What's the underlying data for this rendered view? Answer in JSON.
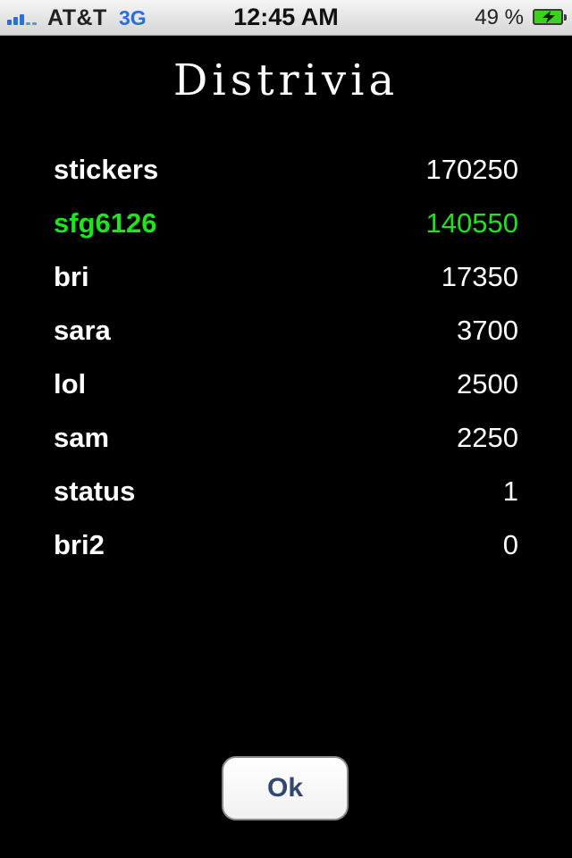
{
  "status_bar": {
    "carrier": "AT&T",
    "network": "3G",
    "time": "12:45 AM",
    "battery_percent": "49 %",
    "signal_icon": "signal-strength-icon",
    "battery_icon": "battery-charging-icon"
  },
  "app": {
    "title": "Distrivia"
  },
  "scores": [
    {
      "name": "stickers",
      "score": "170250",
      "highlight": false
    },
    {
      "name": "sfg6126",
      "score": "140550",
      "highlight": true
    },
    {
      "name": "bri",
      "score": "17350",
      "highlight": false
    },
    {
      "name": "sara",
      "score": "3700",
      "highlight": false
    },
    {
      "name": "lol",
      "score": "2500",
      "highlight": false
    },
    {
      "name": "sam",
      "score": "2250",
      "highlight": false
    },
    {
      "name": "status",
      "score": "1",
      "highlight": false
    },
    {
      "name": "bri2",
      "score": "0",
      "highlight": false
    }
  ],
  "actions": {
    "ok_label": "Ok"
  },
  "colors": {
    "background": "#000000",
    "text": "#ffffff",
    "highlight": "#1fe31f",
    "button_text": "#33476e",
    "network": "#2a6fd6"
  }
}
